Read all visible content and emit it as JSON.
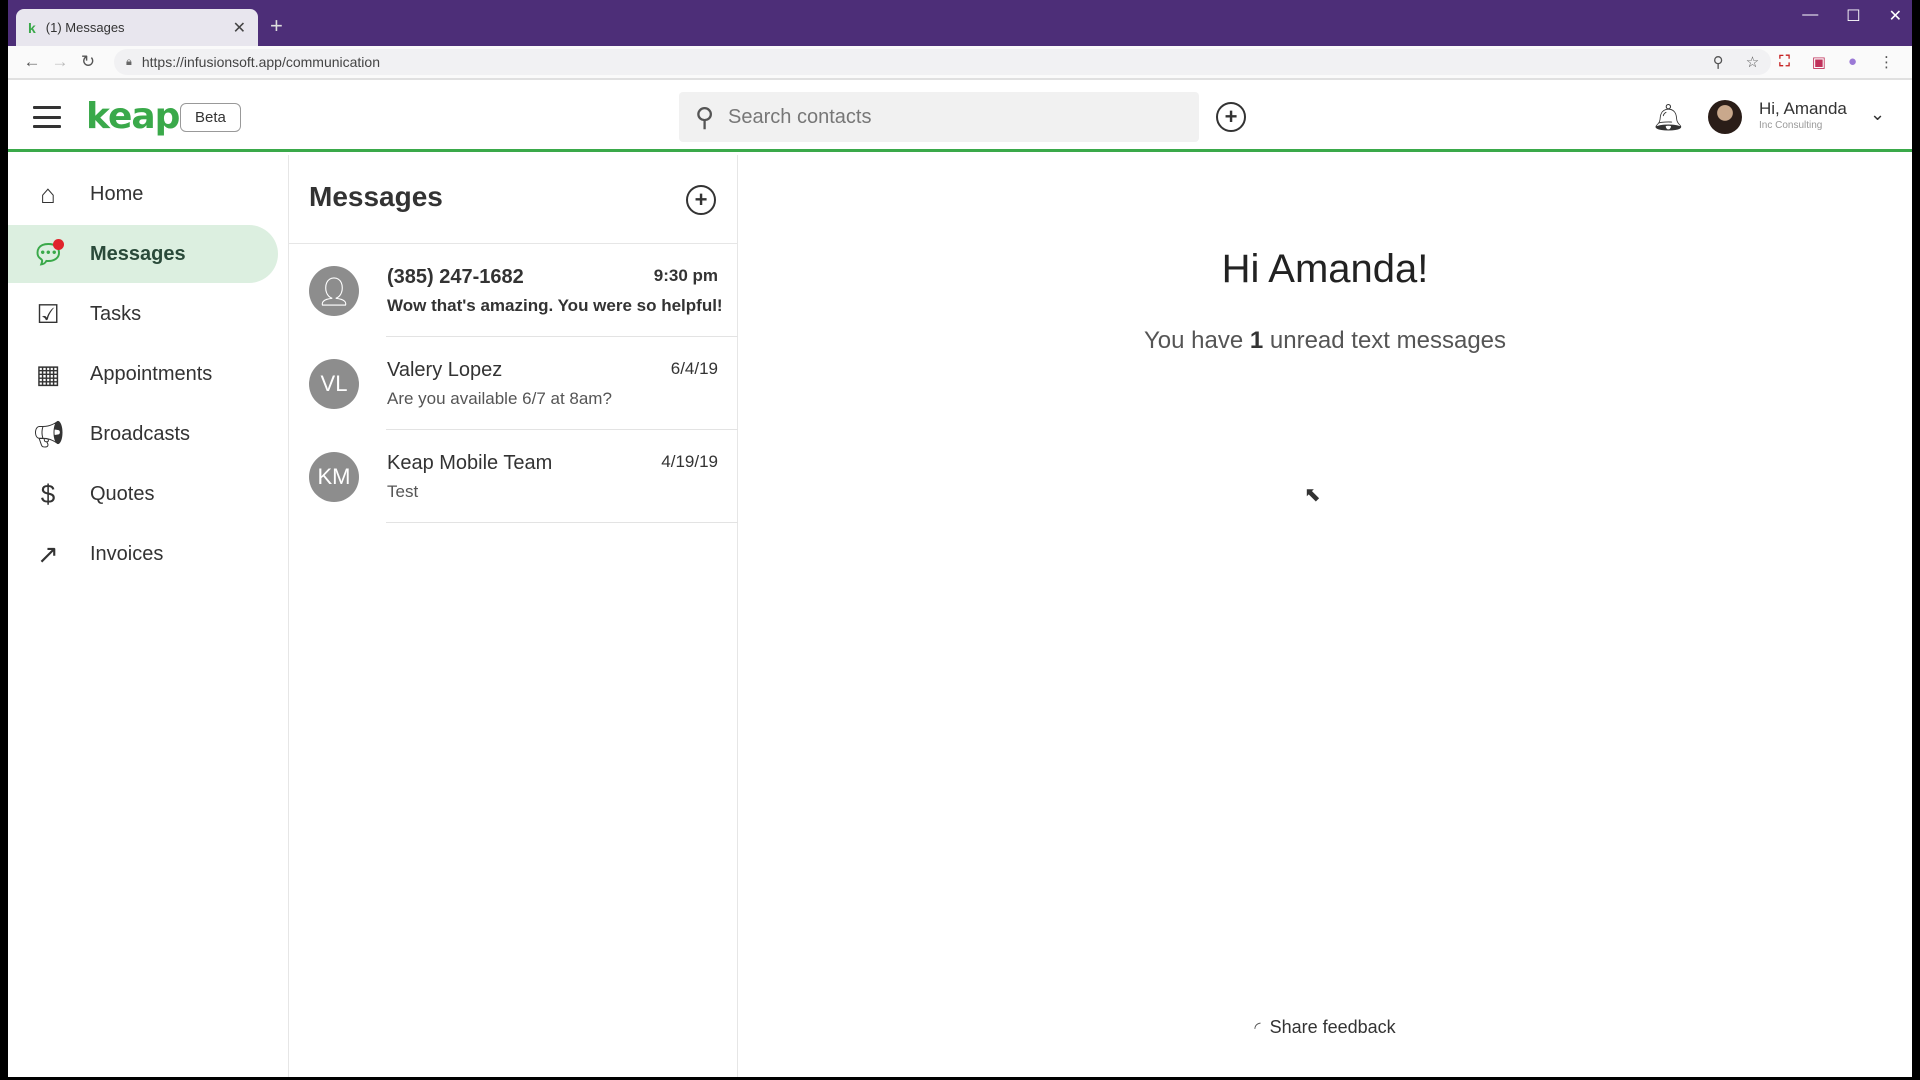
{
  "browser": {
    "tab_title": "(1) Messages",
    "tab_favicon": "k",
    "url": "https://infusionsoft.app/communication",
    "new_tab": "+"
  },
  "header": {
    "logo": "keap",
    "beta": "Beta",
    "search_placeholder": "Search contacts",
    "user_name": "Hi, Amanda",
    "user_company": "Inc Consulting"
  },
  "sidebar": {
    "items": [
      {
        "label": "Home",
        "icon": "home-icon",
        "active": false
      },
      {
        "label": "Messages",
        "icon": "chat-icon",
        "active": true,
        "badge": true
      },
      {
        "label": "Tasks",
        "icon": "checklist-icon",
        "active": false
      },
      {
        "label": "Appointments",
        "icon": "calendar-icon",
        "active": false
      },
      {
        "label": "Broadcasts",
        "icon": "megaphone-icon",
        "active": false
      },
      {
        "label": "Quotes",
        "icon": "dollar-icon",
        "active": false
      },
      {
        "label": "Invoices",
        "icon": "invoice-icon",
        "active": false
      }
    ]
  },
  "messages": {
    "title": "Messages",
    "conversations": [
      {
        "avatar": "",
        "name": "(385) 247-1682",
        "time": "9:30 pm",
        "preview": "Wow that's amazing. You were so helpful!",
        "unread": true
      },
      {
        "avatar": "VL",
        "name": "Valery Lopez",
        "time": "6/4/19",
        "preview": "Are you available 6/7 at 8am?",
        "unread": false
      },
      {
        "avatar": "KM",
        "name": "Keap Mobile Team",
        "time": "4/19/19",
        "preview": "Test",
        "unread": false
      }
    ]
  },
  "main": {
    "greeting": "Hi Amanda!",
    "unread_prefix": "You have",
    "unread_count": "1",
    "unread_suffix": "unread text messages",
    "feedback": "Share feedback"
  },
  "colors": {
    "brand_green": "#3aa94a",
    "browser_purple": "#4d2e78",
    "active_nav_bg": "#dcefe0",
    "badge_red": "#e0242c"
  }
}
